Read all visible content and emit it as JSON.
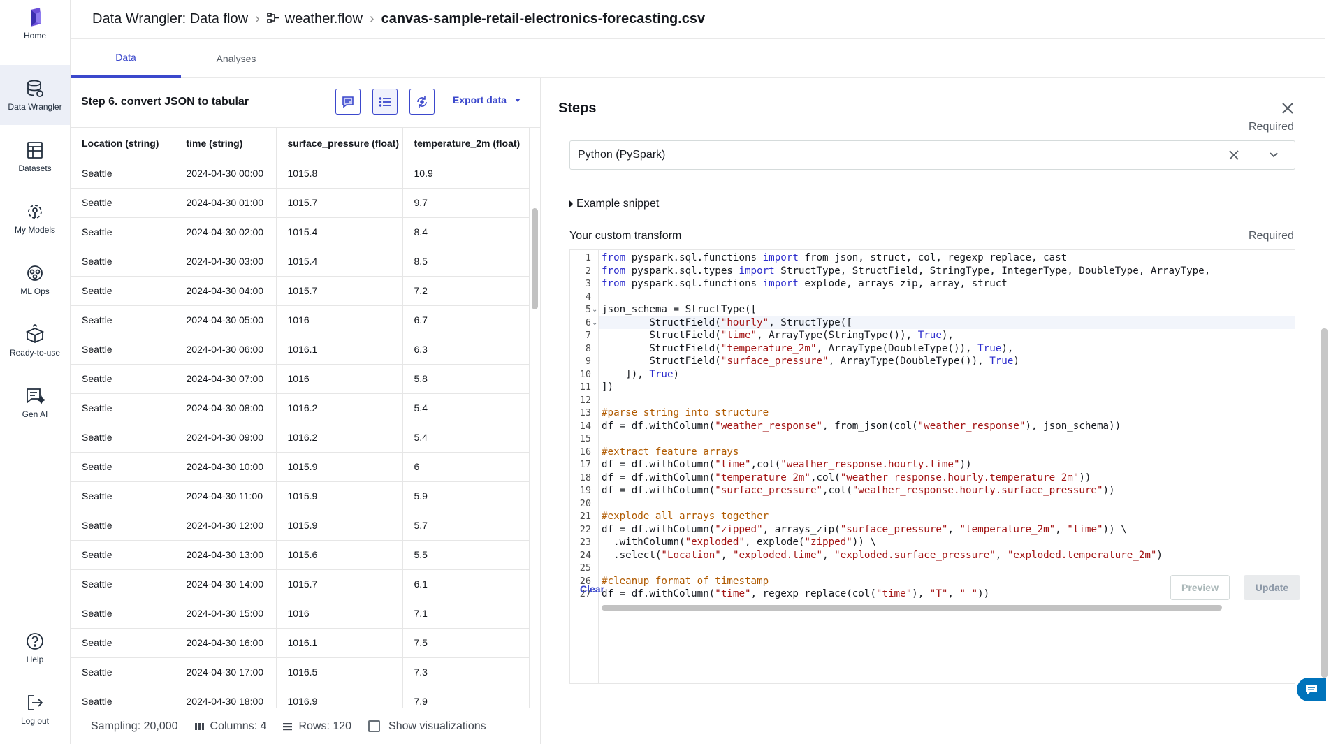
{
  "nav": {
    "items": [
      {
        "label": "Home",
        "icon": "home-logo-icon"
      },
      {
        "label": "Data Wrangler",
        "icon": "database-icon"
      },
      {
        "label": "Datasets",
        "icon": "table-icon"
      },
      {
        "label": "My Models",
        "icon": "models-icon"
      },
      {
        "label": "ML Ops",
        "icon": "mlops-icon"
      },
      {
        "label": "Ready-to-use",
        "icon": "box-icon"
      },
      {
        "label": "Gen AI",
        "icon": "genai-icon"
      },
      {
        "label": "Help",
        "icon": "help-icon"
      },
      {
        "label": "Log out",
        "icon": "logout-icon"
      }
    ]
  },
  "breadcrumb": {
    "part1": "Data Wrangler: Data flow",
    "part2": "weather.flow",
    "part3": "canvas-sample-retail-electronics-forecasting.csv"
  },
  "tabs": {
    "data": "Data",
    "analyses": "Analyses"
  },
  "toolbar": {
    "step_title": "Step 6. convert JSON to tabular",
    "export_label": "Export data"
  },
  "table": {
    "columns": [
      "Location (string)",
      "time (string)",
      "surface_pressure (float)",
      "temperature_2m (float)"
    ],
    "rows": [
      [
        "Seattle",
        "2024-04-30 00:00",
        "1015.8",
        "10.9"
      ],
      [
        "Seattle",
        "2024-04-30 01:00",
        "1015.7",
        "9.7"
      ],
      [
        "Seattle",
        "2024-04-30 02:00",
        "1015.4",
        "8.4"
      ],
      [
        "Seattle",
        "2024-04-30 03:00",
        "1015.4",
        "8.5"
      ],
      [
        "Seattle",
        "2024-04-30 04:00",
        "1015.7",
        "7.2"
      ],
      [
        "Seattle",
        "2024-04-30 05:00",
        "1016",
        "6.7"
      ],
      [
        "Seattle",
        "2024-04-30 06:00",
        "1016.1",
        "6.3"
      ],
      [
        "Seattle",
        "2024-04-30 07:00",
        "1016",
        "5.8"
      ],
      [
        "Seattle",
        "2024-04-30 08:00",
        "1016.2",
        "5.4"
      ],
      [
        "Seattle",
        "2024-04-30 09:00",
        "1016.2",
        "5.4"
      ],
      [
        "Seattle",
        "2024-04-30 10:00",
        "1015.9",
        "6"
      ],
      [
        "Seattle",
        "2024-04-30 11:00",
        "1015.9",
        "5.9"
      ],
      [
        "Seattle",
        "2024-04-30 12:00",
        "1015.9",
        "5.7"
      ],
      [
        "Seattle",
        "2024-04-30 13:00",
        "1015.6",
        "5.5"
      ],
      [
        "Seattle",
        "2024-04-30 14:00",
        "1015.7",
        "6.1"
      ],
      [
        "Seattle",
        "2024-04-30 15:00",
        "1016",
        "7.1"
      ],
      [
        "Seattle",
        "2024-04-30 16:00",
        "1016.1",
        "7.5"
      ],
      [
        "Seattle",
        "2024-04-30 17:00",
        "1016.5",
        "7.3"
      ],
      [
        "Seattle",
        "2024-04-30 18:00",
        "1016.9",
        "7.9"
      ]
    ]
  },
  "footer": {
    "sampling": "Sampling: 20,000",
    "columns": "Columns: 4",
    "rows": "Rows: 120",
    "show_viz": "Show visualizations"
  },
  "steps": {
    "title": "Steps",
    "required": "Required",
    "select_value": "Python (PySpark)",
    "example_snippet": "Example snippet",
    "custom_label": "Your custom transform",
    "clear": "Clear",
    "preview": "Preview",
    "update": "Update"
  },
  "code": [
    "from pyspark.sql.functions import from_json, struct, col, regexp_replace, cast",
    "from pyspark.sql.types import StructType, StructField, StringType, IntegerType, DoubleType, ArrayType,",
    "from pyspark.sql.functions import explode, arrays_zip, array, struct",
    "",
    "json_schema = StructType([",
    "        StructField(\"hourly\", StructType([",
    "        StructField(\"time\", ArrayType(StringType()), True),",
    "        StructField(\"temperature_2m\", ArrayType(DoubleType()), True),",
    "        StructField(\"surface_pressure\", ArrayType(DoubleType()), True)",
    "    ]), True)",
    "])",
    "",
    "#parse string into structure",
    "df = df.withColumn(\"weather_response\", from_json(col(\"weather_response\"), json_schema))",
    "",
    "#extract feature arrays",
    "df = df.withColumn(\"time\",col(\"weather_response.hourly.time\"))",
    "df = df.withColumn(\"temperature_2m\",col(\"weather_response.hourly.temperature_2m\"))",
    "df = df.withColumn(\"surface_pressure\",col(\"weather_response.hourly.surface_pressure\"))",
    "",
    "#explode all arrays together",
    "df = df.withColumn(\"zipped\", arrays_zip(\"surface_pressure\", \"temperature_2m\", \"time\")) \\",
    "  .withColumn(\"exploded\", explode(\"zipped\")) \\",
    "  .select(\"Location\", \"exploded.time\", \"exploded.surface_pressure\", \"exploded.temperature_2m\")",
    "",
    "#cleanup format of timestamp",
    "df = df.withColumn(\"time\", regexp_replace(col(\"time\"), \"T\", \" \"))"
  ],
  "colors": {
    "accent": "#3b48cc",
    "keyword": "#2c2ccc",
    "string": "#a31515",
    "comment": "#b05a00"
  }
}
